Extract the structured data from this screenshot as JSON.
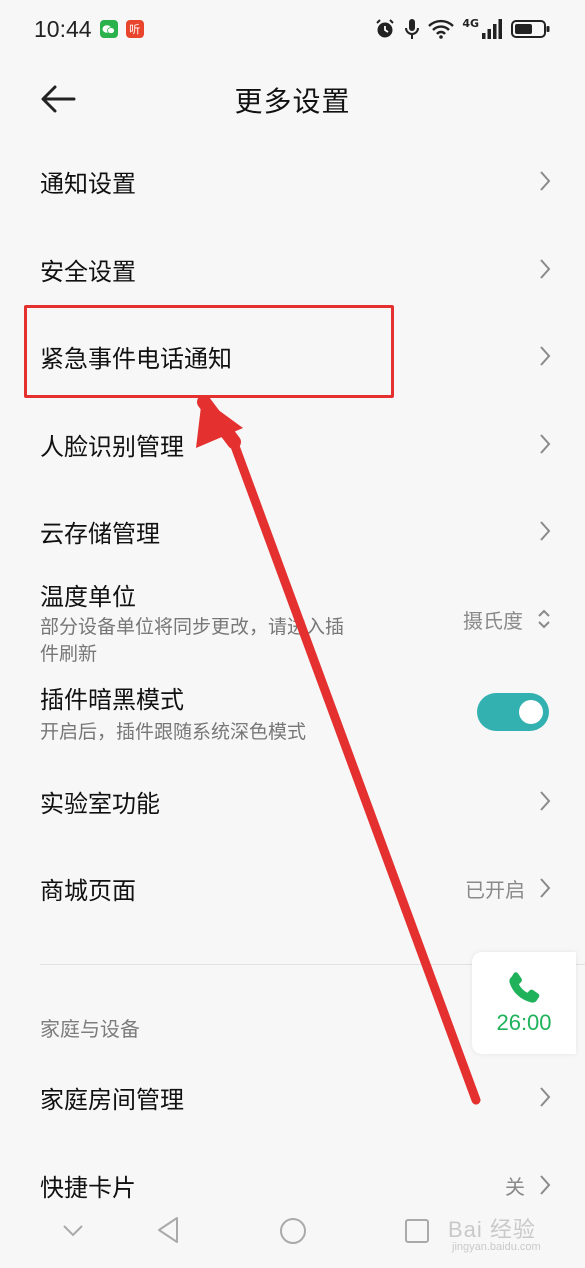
{
  "status_bar": {
    "time": "10:44",
    "badge_right": "听",
    "network": "4G"
  },
  "header": {
    "title": "更多设置"
  },
  "settings": {
    "notification": {
      "label": "通知设置"
    },
    "security": {
      "label": "安全设置"
    },
    "emergency_call": {
      "label": "紧急事件电话通知"
    },
    "face_recognition": {
      "label": "人脸识别管理"
    },
    "cloud_storage": {
      "label": "云存储管理"
    },
    "temperature_unit": {
      "label": "温度单位",
      "description_line1": "部分设备单位将同步更改，请进入插",
      "description_line2": "件刷新",
      "value": "摄氏度"
    },
    "plugin_dark_mode": {
      "label": "插件暗黑模式",
      "description": "开启后，插件跟随系统深色模式",
      "enabled": true
    },
    "lab_features": {
      "label": "实验室功能"
    },
    "mall_page": {
      "label": "商城页面",
      "value": "已开启"
    }
  },
  "sections": {
    "home_devices": {
      "header": "家庭与设备",
      "room_management": {
        "label": "家庭房间管理"
      },
      "quick_cards": {
        "label": "快捷卡片",
        "value": "关"
      }
    }
  },
  "call_float": {
    "duration": "26:00"
  },
  "watermark": {
    "brand": "Bai  经验",
    "url": "jingyan.baidu.com"
  },
  "colors": {
    "accent_toggle": "#33b1b0",
    "call_green": "#1fb25a",
    "annotation_red": "#e53030"
  }
}
